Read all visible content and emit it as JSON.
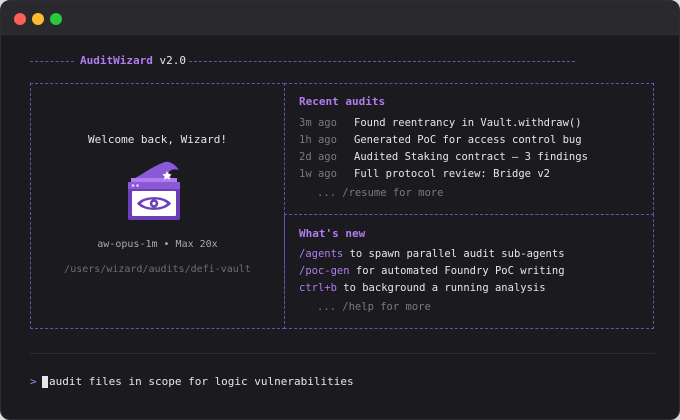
{
  "header": {
    "brand": "AuditWizard",
    "version": "v2.0"
  },
  "welcome": {
    "greeting": "Welcome back, Wizard!",
    "model": "aw-opus-1m • Max 20x",
    "path": "/users/wizard/audits/defi-vault"
  },
  "recent": {
    "title": "Recent audits",
    "items": [
      {
        "time": "3m ago",
        "desc": "Found reentrancy in Vault.withdraw()"
      },
      {
        "time": "1h ago",
        "desc": "Generated PoC for access control bug"
      },
      {
        "time": "2d ago",
        "desc": "Audited Staking contract – 3 findings"
      },
      {
        "time": "1w ago",
        "desc": "Full protocol review: Bridge v2"
      }
    ],
    "more": "... /resume for more"
  },
  "whats_new": {
    "title": "What's new",
    "items": [
      {
        "cmd": "/agents",
        "text": " to spawn parallel audit sub-agents"
      },
      {
        "cmd": "/poc-gen",
        "text": " for automated Foundry PoC writing"
      },
      {
        "cmd": "ctrl+b",
        "text": " to background a running analysis"
      }
    ],
    "more": "... /help for more"
  },
  "prompt": {
    "marker": ">",
    "value": "audit files in scope for logic vulnerabilities"
  },
  "colors": {
    "accent": "#b07cf0",
    "border": "#6b4fb0",
    "background": "#1b1a1f",
    "text": "#e6e6e6",
    "muted": "#7a7980"
  },
  "icons": {
    "logo": "wizard-hat-eye-window-icon"
  }
}
